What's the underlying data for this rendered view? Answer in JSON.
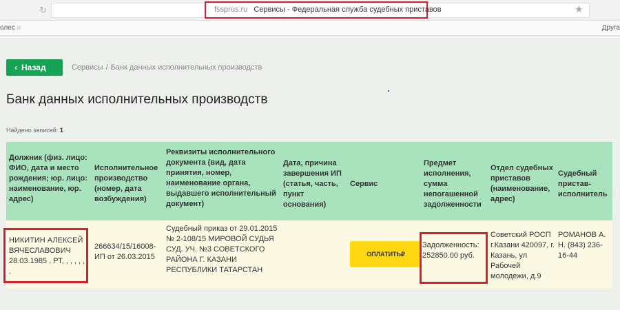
{
  "browser": {
    "url_domain": "fssprus.ru",
    "tab_title": "Сервисы - Федеральная служба судебных приставов",
    "bookmark_left": "олес",
    "bookmark_left_tail": "и",
    "bookmark_right": "Друга"
  },
  "page": {
    "back_label": "Назад",
    "breadcrumb": [
      "Сервисы",
      "Банк данных исполнительных производств"
    ],
    "title": "Банк данных исполнительных производств",
    "found_label": "Найдено записей:",
    "found_count": "1"
  },
  "table": {
    "headers": [
      "Должник (физ. лицо: ФИО, дата и место рождения; юр. лицо: наименование, юр. адрес)",
      "Исполнительное производство (номер, дата возбуждения)",
      "Реквизиты исполнительного документа (вид, дата принятия, номер, наименование органа, выдавшего исполнительный документ)",
      "Дата, причина завершения ИП (статья, часть, пункт основания)",
      "Сервис",
      "Предмет исполнения, сумма непогашенной задолженности",
      "Отдел судебных приставов (наименование, адрес)",
      "Судебный пристав-исполнитель"
    ],
    "row": {
      "debtor": "НИКИТИН АЛЕКСЕЙ ВЯЧЕСЛАВОВИЧ 28.03.1985 , РТ, , , , , , ,",
      "proceeding": "266634/15/16008-ИП от 26.03.2015",
      "document": "Судебный приказ от 29.01.2015 № 2-108/15 МИРОВОЙ СУДЬЯ СУД. УЧ. №3 СОВЕТСКОГО РАЙОНА Г. КАЗАНИ РЕСПУБЛИКИ ТАТАРСТАН",
      "completion": "",
      "pay_label": "ОПЛАТИТЬ₽",
      "subject": "Задолженность: 252850.00 руб.",
      "department": "Советский РОСП г.Казани 420097, г. Казань, ул Рабочей молодежи, д.9",
      "bailiff": "РОМАНОВ А. Н. (843) 236-16-44"
    }
  },
  "colors": {
    "header_bg": "#a8e3bd",
    "row_bg": "#fbf9e4",
    "back_button": "#17a355",
    "pay_button": "#ffd811",
    "highlight": "#d6202b"
  },
  "icons": {
    "reload": "reload-icon",
    "star": "star-icon",
    "back": "chevron-left-icon"
  }
}
